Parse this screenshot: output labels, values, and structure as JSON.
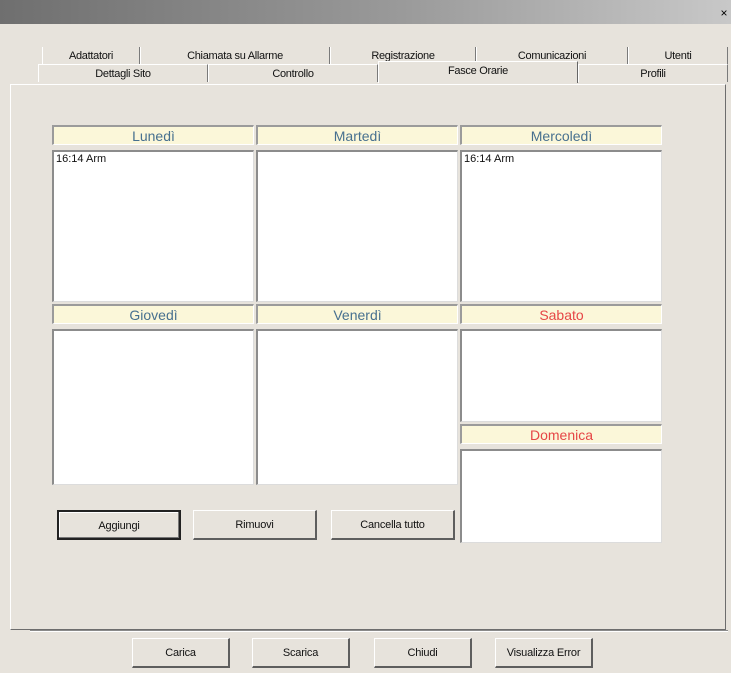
{
  "window": {
    "close_glyph": "×"
  },
  "tabs": {
    "row1": [
      "Adattatori",
      "Chiamata su Allarme",
      "Registrazione",
      "Comunicazioni",
      "Utenti"
    ],
    "row2": [
      "Dettagli Sito",
      "Controllo",
      "Fasce Orarie",
      "Profili"
    ],
    "active": "Fasce Orarie"
  },
  "days": {
    "monday": {
      "label": "Lunedì",
      "entries": [
        "16:14 Arm"
      ]
    },
    "tuesday": {
      "label": "Martedì",
      "entries": []
    },
    "wednesday": {
      "label": "Mercoledì",
      "entries": [
        "16:14 Arm"
      ]
    },
    "thursday": {
      "label": "Giovedì",
      "entries": []
    },
    "friday": {
      "label": "Venerdì",
      "entries": []
    },
    "saturday": {
      "label": "Sabato",
      "entries": []
    },
    "sunday": {
      "label": "Domenica",
      "entries": []
    }
  },
  "actions": {
    "add": "Aggiungi",
    "remove": "Rimuovi",
    "clear_all": "Cancella tutto"
  },
  "footer": {
    "load": "Carica",
    "download": "Scarica",
    "close": "Chiudi",
    "show_errors": "Visualizza Error"
  },
  "colors": {
    "header_bg": "#fbf7d9",
    "weekday_text": "#47708f",
    "weekend_text": "#e64646",
    "dialog_bg": "#e7e3dc"
  }
}
